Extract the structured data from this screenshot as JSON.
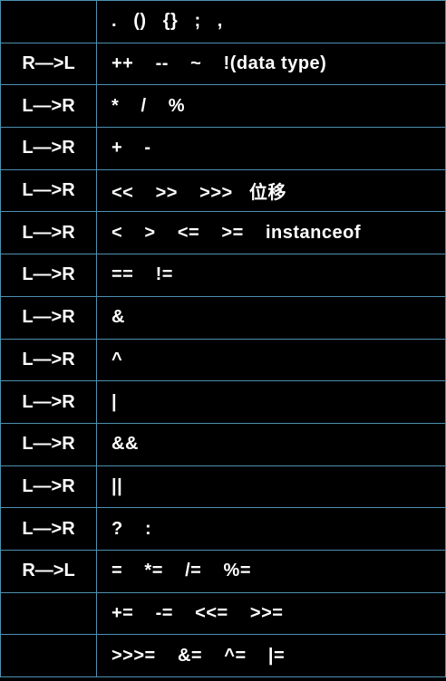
{
  "table": {
    "rows": [
      {
        "assoc": "",
        "ops": ".   ()   {}   ;   ,"
      },
      {
        "assoc": "R—>L",
        "ops": "++    --    ~    !(data type)"
      },
      {
        "assoc": "L—>R",
        "ops": "*    /    %"
      },
      {
        "assoc": "L—>R",
        "ops": "+    -"
      },
      {
        "assoc": "L—>R",
        "ops": "<<    >>    >>>   位移"
      },
      {
        "assoc": "L—>R",
        "ops": "<    >    <=    >=    instanceof"
      },
      {
        "assoc": "L—>R",
        "ops": "==    !="
      },
      {
        "assoc": "L—>R",
        "ops": "&"
      },
      {
        "assoc": "L—>R",
        "ops": "^"
      },
      {
        "assoc": "L—>R",
        "ops": "|"
      },
      {
        "assoc": "L—>R",
        "ops": "&&"
      },
      {
        "assoc": "L—>R",
        "ops": "||"
      },
      {
        "assoc": "L—>R",
        "ops": "?    :"
      },
      {
        "assoc": "R—>L",
        "ops": "=    *=    /=    %="
      },
      {
        "assoc": "",
        "ops": "+=    -=    <<=    >>="
      },
      {
        "assoc": "",
        "ops": ">>>=    &=    ^=    |="
      }
    ]
  },
  "colors": {
    "background": "#000000",
    "text": "#ffffff",
    "grid": "#4f8fb0"
  }
}
